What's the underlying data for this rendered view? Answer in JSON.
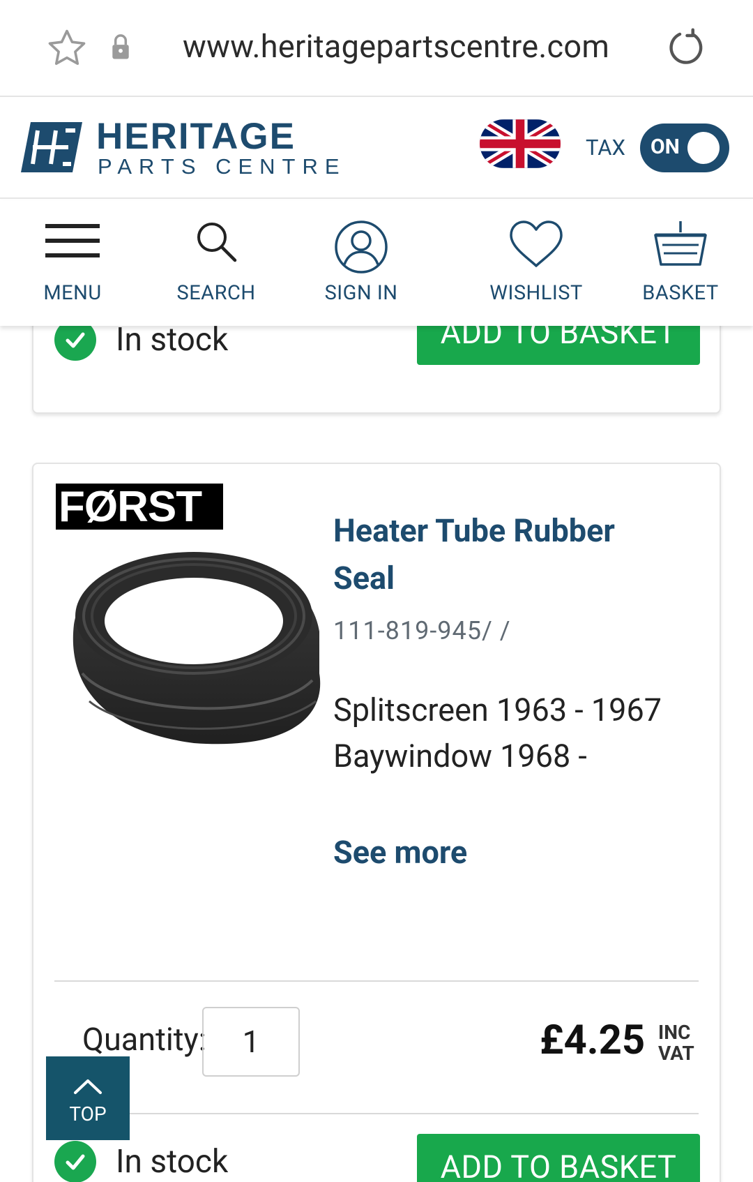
{
  "browser": {
    "url": "www.heritagepartscentre.com"
  },
  "header": {
    "logo_title": "HERITAGE",
    "logo_subtitle": "PARTS CENTRE",
    "tax_label": "TAX",
    "tax_toggle": "ON"
  },
  "nav": {
    "menu": "MENU",
    "search": "SEARCH",
    "sign_in": "SIGN IN",
    "wishlist": "WISHLIST",
    "basket": "BASKET"
  },
  "previous_card": {
    "stock": "In stock",
    "add_to_basket": "ADD TO BASKET"
  },
  "product": {
    "brand": "FØRST",
    "title": "Heater Tube Rubber Seal",
    "code": "111-819-945/ /",
    "fitment_line1": "Splitscreen 1963 - 1967",
    "fitment_line2": "Baywindow 1968 -",
    "see_more": "See more",
    "quantity_label": "Quantity:",
    "quantity_value": "1",
    "price": "£4.25",
    "vat_line1": "INC",
    "vat_line2": "VAT",
    "stock": "In stock",
    "add_to_basket": "ADD TO BASKET"
  },
  "back_to_top": "TOP",
  "colors": {
    "brand_blue": "#1d4b6e",
    "button_green": "#18a84c",
    "check_green": "#1aa750",
    "top_button": "#15546a"
  }
}
